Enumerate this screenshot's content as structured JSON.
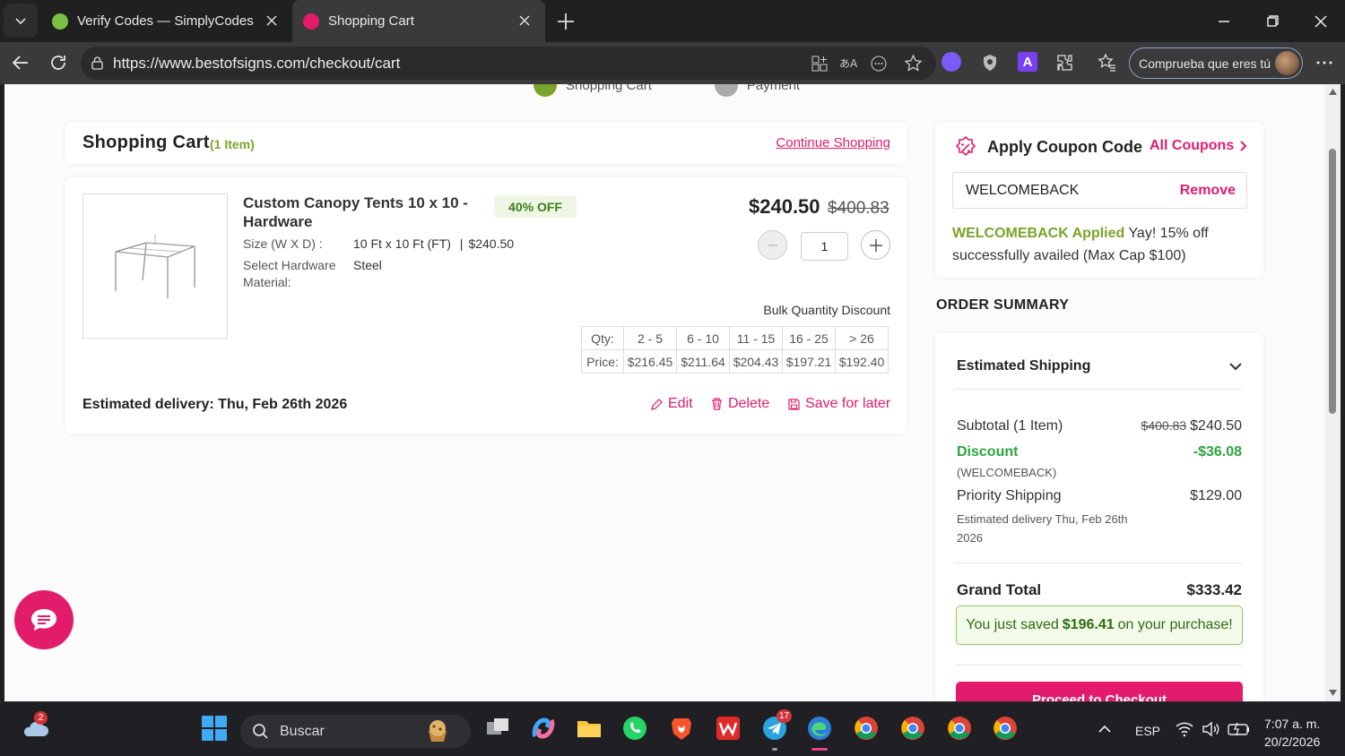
{
  "browser": {
    "tabs": [
      {
        "title": "Verify Codes — SimplyCodes"
      },
      {
        "title": "Shopping Cart"
      }
    ],
    "url": "https://www.bestofsigns.com/checkout/cart",
    "profile_label": "Comprueba que eres tú"
  },
  "steps": [
    {
      "label": "Shopping Cart"
    },
    {
      "label": "Payment"
    }
  ],
  "cart": {
    "title": "Shopping Cart",
    "count_label": "(1 Item)",
    "continue_label": "Continue Shopping"
  },
  "item": {
    "name": "Custom Canopy Tents 10 x 10 - Hardware",
    "discount_badge": "40% OFF",
    "specs": [
      {
        "key": "Size (W X D) :",
        "value": "10 Ft x 10 Ft (FT)",
        "extra": "$240.50"
      },
      {
        "key": "Select Hardware Material:",
        "value": "Steel"
      }
    ],
    "price": "$240.50",
    "original_price": "$400.83",
    "quantity": "1",
    "bulk_title": "Bulk Quantity Discount",
    "bulk_table": {
      "qty_label": "Qty:",
      "price_label": "Price:",
      "ranges": [
        "2 - 5",
        "6 - 10",
        "11 - 15",
        "16 - 25",
        "> 26"
      ],
      "prices": [
        "$216.45",
        "$211.64",
        "$204.43",
        "$197.21",
        "$192.40"
      ]
    },
    "delivery": "Estimated delivery: Thu, Feb 26th 2026",
    "actions": {
      "edit": "Edit",
      "delete": "Delete",
      "save": "Save for later"
    }
  },
  "coupon": {
    "title": "Apply Coupon Code",
    "all_label": "All Coupons",
    "code": "WELCOMEBACK",
    "remove_label": "Remove",
    "applied_code": "WELCOMEBACK Applied",
    "applied_msg": "Yay! 15% off successfully availed (Max Cap $100)"
  },
  "summary": {
    "title": "ORDER SUMMARY",
    "shipping_label": "Estimated Shipping",
    "subtotal_label": "Subtotal (1 Item)",
    "subtotal_old": "$400.83",
    "subtotal": "$240.50",
    "discount_label": "Discount",
    "discount_code": "(WELCOMEBACK)",
    "discount_value": "-$36.08",
    "priority_label": "Priority Shipping",
    "priority_value": "$129.00",
    "priority_delivery": "Estimated delivery Thu, Feb 26th 2026",
    "grand_label": "Grand Total",
    "grand_value": "$333.42",
    "saved_prefix": "You just saved",
    "saved_amount": "$196.41",
    "saved_suffix": "on your purchase!",
    "checkout_label": "Proceed to Checkout"
  },
  "taskbar": {
    "search_placeholder": "Buscar",
    "weather_badge": "2",
    "telegram_badge": "17",
    "lang": "ESP",
    "time": "7:07 a. m.",
    "date": "20/2/2026"
  },
  "colors": {
    "accent": "#e21c6b",
    "green": "#7aa329",
    "discount_green": "#2aa53a"
  }
}
